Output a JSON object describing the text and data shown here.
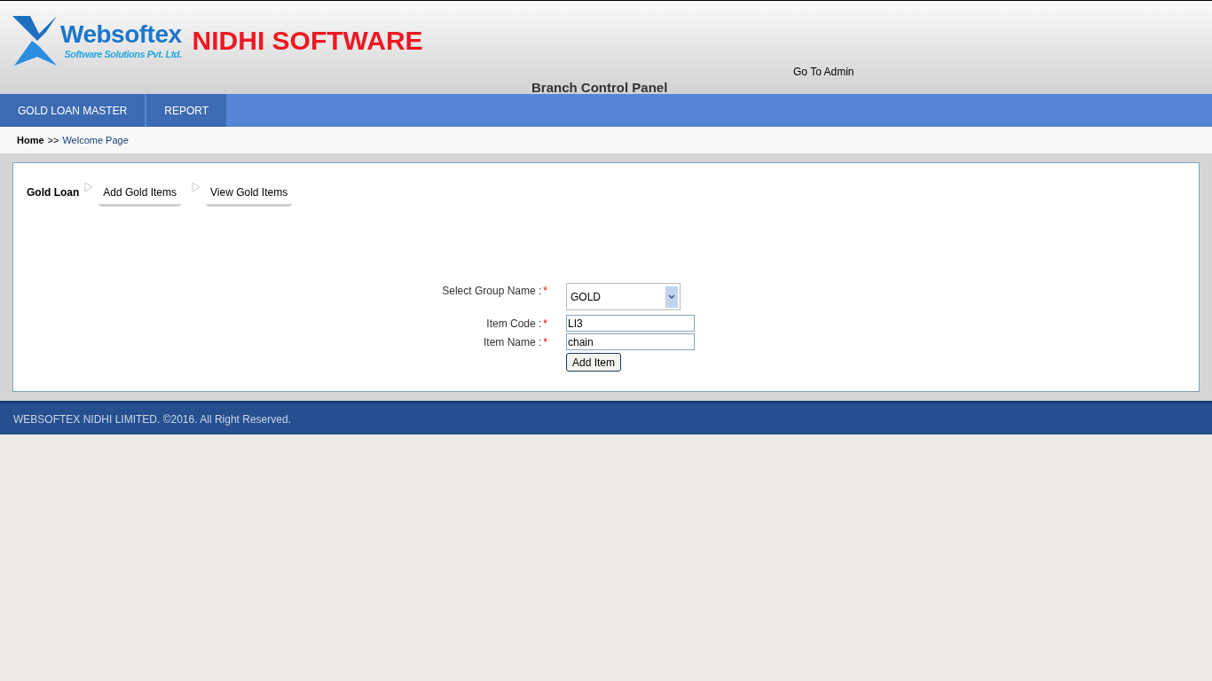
{
  "header": {
    "logo_name": "Websoftex",
    "logo_tagline": "Software Solutions Pvt. Ltd.",
    "product": "NIDHI SOFTWARE",
    "admin_link": "Go To Admin",
    "panel_title": "Branch Control Panel"
  },
  "nav": [
    {
      "label": "GOLD LOAN MASTER",
      "selected": false
    },
    {
      "label": "REPORT",
      "selected": false
    }
  ],
  "breadcrumb": {
    "home": "Home",
    "separator": ">>",
    "current": "Welcome Page"
  },
  "subtabs": {
    "title": "Gold Loan",
    "items": [
      {
        "label": "Add Gold Items",
        "selected": false
      },
      {
        "label": "View Gold Items",
        "selected": false
      }
    ]
  },
  "form": {
    "fields": [
      {
        "kind": "select",
        "label": "Select Group Name :",
        "required_mark": "*",
        "value": "GOLD"
      },
      {
        "kind": "text",
        "label": "Item Code :",
        "required_mark": "*",
        "value": "LI3"
      },
      {
        "kind": "text",
        "label": "Item Name :",
        "required_mark": "*",
        "value": "chain"
      }
    ],
    "button": "Add Item"
  },
  "footer": "WEBSOFTEX NIDHI LIMITED. ©2016. All Right Reserved."
}
